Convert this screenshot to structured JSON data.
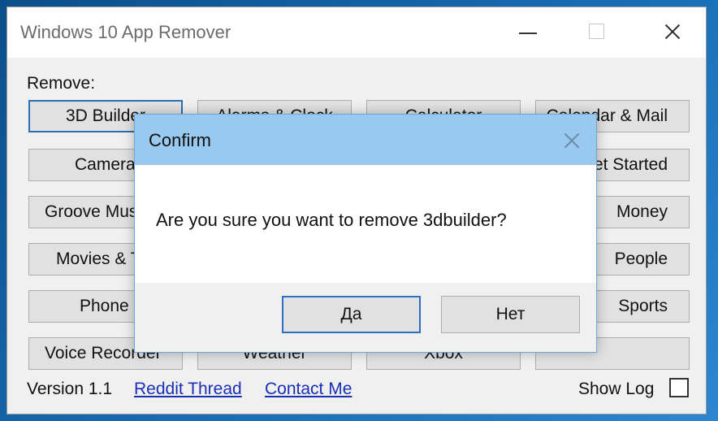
{
  "window": {
    "title": "Windows 10 App Remover"
  },
  "main": {
    "remove_label": "Remove:",
    "app_buttons": [
      "3D Builder",
      "Alarms & Clock",
      "Calculator",
      "Calendar & Mail",
      "Camera",
      "",
      "",
      "Get Started",
      "Groove Music",
      "",
      "",
      "Money",
      "Movies & TV",
      "",
      "",
      "People",
      "Phone",
      "",
      "",
      "Sports",
      "Voice Recorder",
      "Weather",
      "Xbox",
      ""
    ]
  },
  "footer": {
    "version": "Version 1.1",
    "reddit_link": "Reddit Thread",
    "contact_link": "Contact Me",
    "show_log_label": "Show Log",
    "show_log_checked": false
  },
  "dialog": {
    "title": "Confirm",
    "message": "Are you sure you want to remove 3dbuilder?",
    "yes_label": "Да",
    "no_label": "Нет"
  },
  "colors": {
    "dialog_title_bg": "#99c9ef",
    "focus_border": "#2a6db5",
    "link": "#1a2fb5",
    "desktop": "#1a6fb8"
  }
}
